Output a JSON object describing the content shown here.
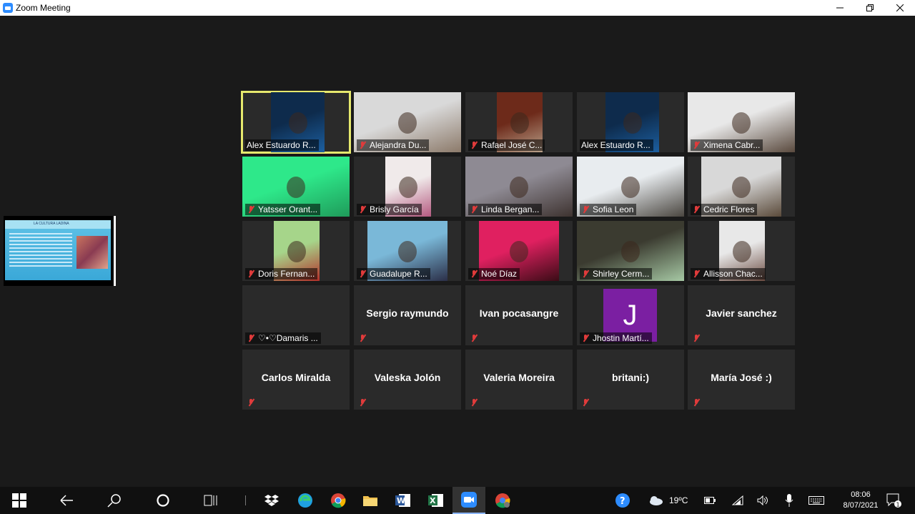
{
  "window": {
    "title": "Zoom Meeting",
    "controls": [
      "minimize",
      "restore",
      "close"
    ]
  },
  "shared_screen": {
    "slide_title": "LA CULTURA LADINA"
  },
  "participants": [
    {
      "name": "Alex Estuardo R...",
      "video": true,
      "muted": false,
      "active": true,
      "bg": [
        "#0e2b4c",
        "#1c5fa0"
      ]
    },
    {
      "name": "Alejandra Du...",
      "video": true,
      "muted": true,
      "bg": [
        "#d9d9d9",
        "#8c7a6a"
      ]
    },
    {
      "name": "Rafael José C...",
      "video": true,
      "muted": true,
      "bg": [
        "#6d2a1a",
        "#b9a18a"
      ]
    },
    {
      "name": "Alex Estuardo R...",
      "video": true,
      "muted": false,
      "bg": [
        "#0e2b4c",
        "#1c5fa0"
      ]
    },
    {
      "name": "Ximena Cabr...",
      "video": true,
      "muted": true,
      "bg": [
        "#e8e8e8",
        "#5a4a3e"
      ]
    },
    {
      "name": "Yatsser Orant...",
      "video": true,
      "muted": true,
      "bg": [
        "#2ee88a",
        "#1f9b5a"
      ]
    },
    {
      "name": "Brisly García",
      "video": true,
      "muted": true,
      "bg": [
        "#f0eaea",
        "#b55a80"
      ]
    },
    {
      "name": "Linda Bergan...",
      "video": true,
      "muted": true,
      "bg": [
        "#8e8a93",
        "#3e3330"
      ]
    },
    {
      "name": "Sofia Leon",
      "video": true,
      "muted": true,
      "bg": [
        "#e8ecef",
        "#4a4640"
      ]
    },
    {
      "name": "Cedric Flores",
      "video": true,
      "muted": true,
      "bg": [
        "#d8d8d8",
        "#5a4a3a"
      ]
    },
    {
      "name": "Doris Fernan...",
      "video": true,
      "muted": true,
      "bg": [
        "#a6d58a",
        "#b3302a"
      ]
    },
    {
      "name": "Guadalupe R...",
      "video": true,
      "muted": true,
      "bg": [
        "#7ab8d8",
        "#2b2f48"
      ]
    },
    {
      "name": "Noé Díaz",
      "video": true,
      "muted": true,
      "bg": [
        "#e02060",
        "#3a0c16"
      ]
    },
    {
      "name": "Shirley Cerm...",
      "video": true,
      "muted": true,
      "bg": [
        "#3b3b30",
        "#a6c8a4"
      ]
    },
    {
      "name": "Allisson Chac...",
      "video": true,
      "muted": true,
      "bg": [
        "#e8e8e8",
        "#6a4a40"
      ]
    },
    {
      "name": "♡•♡Damaris ...",
      "video": false,
      "muted": true,
      "display": "",
      "label": true
    },
    {
      "name": "Sergio raymundo",
      "video": false,
      "muted": true,
      "display": "Sergio raymundo"
    },
    {
      "name": "Ivan pocasangre",
      "video": false,
      "muted": true,
      "display": "Ivan pocasangre"
    },
    {
      "name": "Jhostin Martí...",
      "video": false,
      "muted": true,
      "avatar": "J",
      "label": true
    },
    {
      "name": "Javier sanchez",
      "video": false,
      "muted": true,
      "display": "Javier sanchez"
    },
    {
      "name": "Carlos Miralda",
      "video": false,
      "muted": true,
      "display": "Carlos Miralda"
    },
    {
      "name": "Valeska Jolón",
      "video": false,
      "muted": true,
      "display": "Valeska Jolón"
    },
    {
      "name": "Valeria Moreira",
      "video": false,
      "muted": true,
      "display": "Valeria Moreira"
    },
    {
      "name": "britani:)",
      "video": false,
      "muted": true,
      "display": "britani:)"
    },
    {
      "name": "María José :)",
      "video": false,
      "muted": true,
      "display": "María José :)"
    }
  ],
  "taskbar": {
    "apps": [
      "windows-start",
      "back",
      "search",
      "cortana",
      "task-view",
      "dropbox",
      "edge",
      "chrome",
      "file-explorer",
      "word",
      "excel",
      "zoom",
      "chrome-profile"
    ],
    "weather": "19ºC",
    "time": "08:06",
    "date": "8/07/2021",
    "notifications": "1"
  }
}
